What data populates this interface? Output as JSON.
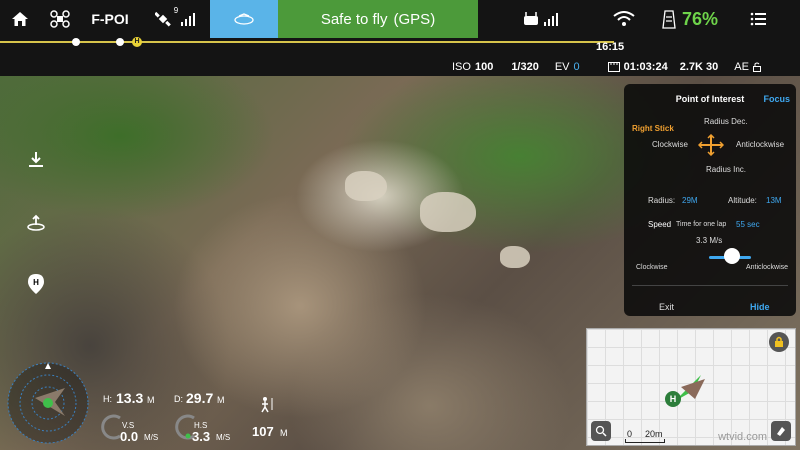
{
  "topbar": {
    "mode": "F-POI",
    "gps_count": "9",
    "status": "Safe to fly",
    "status_gps": "(GPS)",
    "battery_percent": "76%"
  },
  "flight": {
    "time_remaining": "16:15"
  },
  "camera": {
    "iso_label": "ISO",
    "iso_value": "100",
    "shutter": "1/320",
    "ev_label": "EV",
    "ev_value": "0",
    "record_time": "01:03:24",
    "resolution": "2.7K 30",
    "ae_label": "AE"
  },
  "poi_panel": {
    "title": "Point of Interest",
    "focus": "Focus",
    "right_stick": "Right Stick",
    "radius_dec": "Radius Dec.",
    "clockwise": "Clockwise",
    "anticlockwise": "Anticlockwise",
    "radius_inc": "Radius Inc.",
    "radius_label": "Radius:",
    "radius_value": "29M",
    "altitude_label": "Altitude:",
    "altitude_value": "13M",
    "speed_label": "Speed",
    "lap_text": "Time for one lap",
    "lap_value": "55 sec",
    "speed_value": "3.3 M/s",
    "slider_left": "Clockwise",
    "slider_right": "Anticlockwise",
    "exit": "Exit",
    "hide": "Hide"
  },
  "telemetry": {
    "h_label": "H:",
    "h_value": "13.3",
    "h_unit": "M",
    "d_label": "D:",
    "d_value": "29.7",
    "d_unit": "M",
    "vs_label": "V.S",
    "vs_value": "0.0",
    "vs_unit": "M/S",
    "hs_label": "H.S",
    "hs_value": "3.3",
    "hs_unit": "M/S",
    "vps_value": "107",
    "vps_unit": "M"
  },
  "map": {
    "scale_zero": "0",
    "scale_label": "20m",
    "home_marker": "H",
    "watermark": "wtvid.com"
  },
  "colors": {
    "status_green": "#4c9a3a",
    "accent_blue": "#3fa8f0",
    "battery_green": "#6ed34a",
    "warning_yellow": "#e9d236",
    "right_stick_orange": "#f0a030"
  }
}
